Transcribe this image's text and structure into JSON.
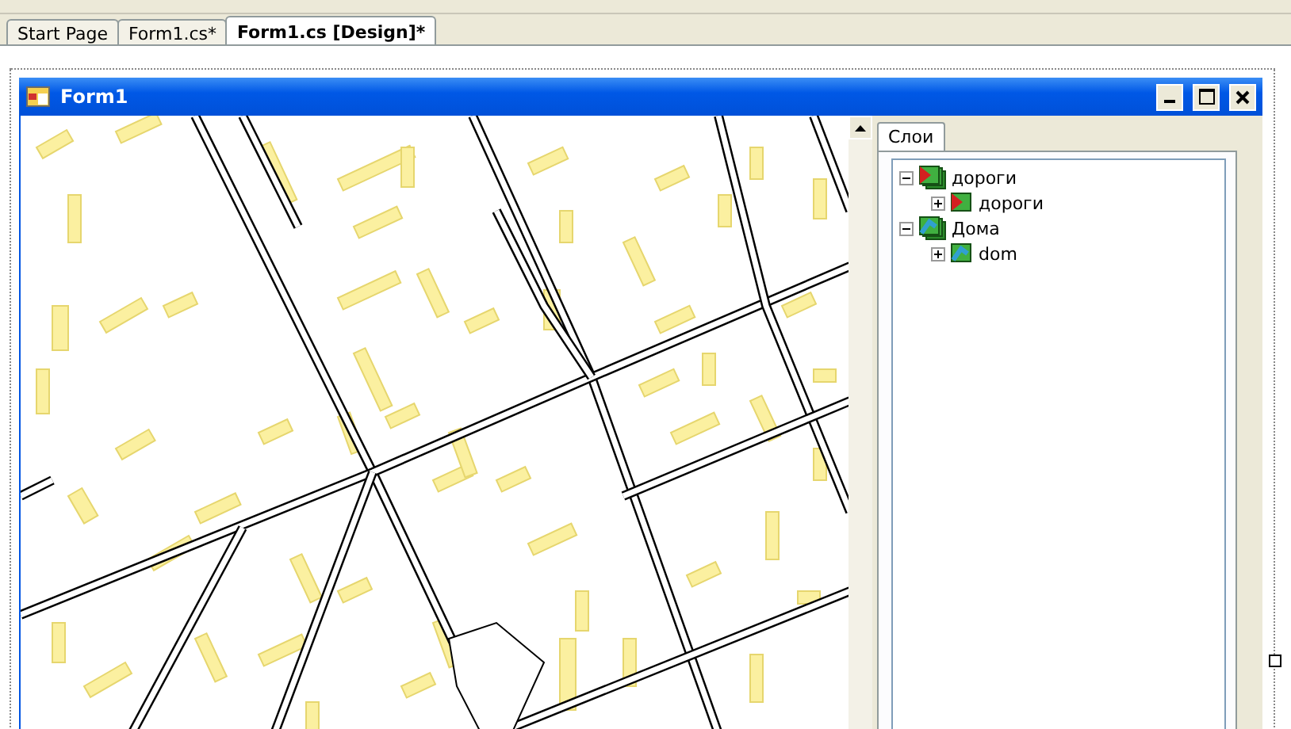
{
  "tabs": [
    {
      "label": "Start Page",
      "selected": false
    },
    {
      "label": "Form1.cs*",
      "selected": false
    },
    {
      "label": "Form1.cs [Design]*",
      "selected": true
    }
  ],
  "window": {
    "title": "Form1"
  },
  "layers_panel": {
    "tabs": [
      {
        "label": "Слои",
        "selected": true
      }
    ],
    "tree": [
      {
        "label": "дороги",
        "kind": "roads",
        "expanded": true,
        "children": [
          {
            "label": "дороги",
            "kind": "roads",
            "expanded": false
          }
        ]
      },
      {
        "label": "Дома",
        "kind": "buildings",
        "expanded": true,
        "children": [
          {
            "label": "dom",
            "kind": "buildings",
            "expanded": false
          }
        ]
      }
    ]
  }
}
